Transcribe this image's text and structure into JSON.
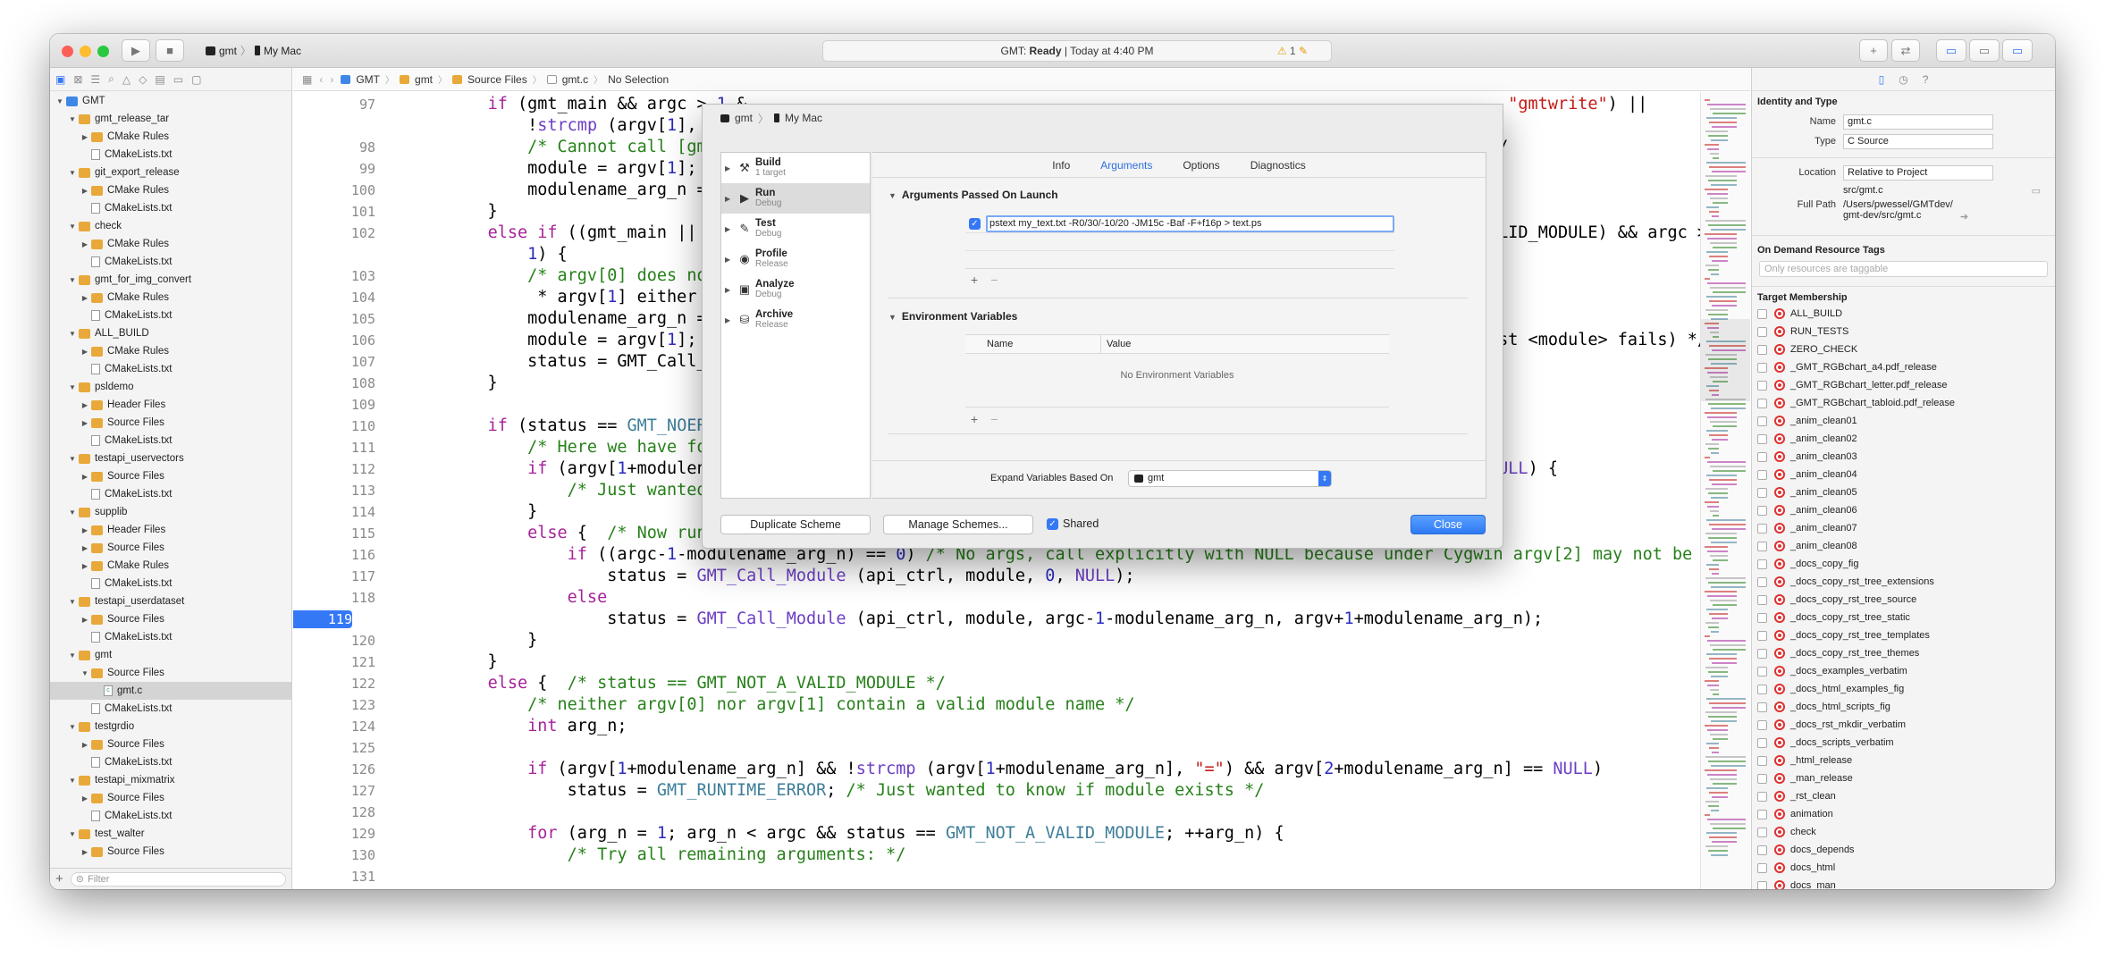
{
  "toolbar": {
    "scheme_target": "gmt",
    "scheme_device": "My Mac",
    "status_prefix": "GMT:",
    "status_state": "Ready",
    "status_time": "| Today at 4:40 PM",
    "warning_count": "1"
  },
  "navigator": {
    "items": [
      {
        "label": "GMT",
        "depth": 0,
        "kind": "project",
        "open": true
      },
      {
        "label": "gmt_release_tar",
        "depth": 1,
        "kind": "folder",
        "open": true
      },
      {
        "label": "CMake Rules",
        "depth": 2,
        "kind": "folder",
        "open": false
      },
      {
        "label": "CMakeLists.txt",
        "depth": 2,
        "kind": "file"
      },
      {
        "label": "git_export_release",
        "depth": 1,
        "kind": "folder",
        "open": true
      },
      {
        "label": "CMake Rules",
        "depth": 2,
        "kind": "folder",
        "open": false
      },
      {
        "label": "CMakeLists.txt",
        "depth": 2,
        "kind": "file"
      },
      {
        "label": "check",
        "depth": 1,
        "kind": "folder",
        "open": true
      },
      {
        "label": "CMake Rules",
        "depth": 2,
        "kind": "folder",
        "open": false
      },
      {
        "label": "CMakeLists.txt",
        "depth": 2,
        "kind": "file"
      },
      {
        "label": "gmt_for_img_convert",
        "depth": 1,
        "kind": "folder",
        "open": true
      },
      {
        "label": "CMake Rules",
        "depth": 2,
        "kind": "folder",
        "open": false
      },
      {
        "label": "CMakeLists.txt",
        "depth": 2,
        "kind": "file"
      },
      {
        "label": "ALL_BUILD",
        "depth": 1,
        "kind": "folder",
        "open": true
      },
      {
        "label": "CMake Rules",
        "depth": 2,
        "kind": "folder",
        "open": false
      },
      {
        "label": "CMakeLists.txt",
        "depth": 2,
        "kind": "file"
      },
      {
        "label": "psldemo",
        "depth": 1,
        "kind": "folder",
        "open": true
      },
      {
        "label": "Header Files",
        "depth": 2,
        "kind": "folder",
        "open": false
      },
      {
        "label": "Source Files",
        "depth": 2,
        "kind": "folder",
        "open": false
      },
      {
        "label": "CMakeLists.txt",
        "depth": 2,
        "kind": "file"
      },
      {
        "label": "testapi_uservectors",
        "depth": 1,
        "kind": "folder",
        "open": true
      },
      {
        "label": "Source Files",
        "depth": 2,
        "kind": "folder",
        "open": false
      },
      {
        "label": "CMakeLists.txt",
        "depth": 2,
        "kind": "file"
      },
      {
        "label": "supplib",
        "depth": 1,
        "kind": "folder",
        "open": true
      },
      {
        "label": "Header Files",
        "depth": 2,
        "kind": "folder",
        "open": false
      },
      {
        "label": "Source Files",
        "depth": 2,
        "kind": "folder",
        "open": false
      },
      {
        "label": "CMake Rules",
        "depth": 2,
        "kind": "folder",
        "open": false
      },
      {
        "label": "CMakeLists.txt",
        "depth": 2,
        "kind": "file"
      },
      {
        "label": "testapi_userdataset",
        "depth": 1,
        "kind": "folder",
        "open": true
      },
      {
        "label": "Source Files",
        "depth": 2,
        "kind": "folder",
        "open": false
      },
      {
        "label": "CMakeLists.txt",
        "depth": 2,
        "kind": "file"
      },
      {
        "label": "gmt",
        "depth": 1,
        "kind": "folder",
        "open": true
      },
      {
        "label": "Source Files",
        "depth": 2,
        "kind": "folder",
        "open": true
      },
      {
        "label": "gmt.c",
        "depth": 3,
        "kind": "cfile",
        "selected": true
      },
      {
        "label": "CMakeLists.txt",
        "depth": 2,
        "kind": "file"
      },
      {
        "label": "testgrdio",
        "depth": 1,
        "kind": "folder",
        "open": true
      },
      {
        "label": "Source Files",
        "depth": 2,
        "kind": "folder",
        "open": false
      },
      {
        "label": "CMakeLists.txt",
        "depth": 2,
        "kind": "file"
      },
      {
        "label": "testapi_mixmatrix",
        "depth": 1,
        "kind": "folder",
        "open": true
      },
      {
        "label": "Source Files",
        "depth": 2,
        "kind": "folder",
        "open": false
      },
      {
        "label": "CMakeLists.txt",
        "depth": 2,
        "kind": "file"
      },
      {
        "label": "test_walter",
        "depth": 1,
        "kind": "folder",
        "open": true
      },
      {
        "label": "Source Files",
        "depth": 2,
        "kind": "folder",
        "open": false
      }
    ],
    "filter_placeholder": "Filter"
  },
  "jumpbar": {
    "crumbs": [
      "GMT",
      "gmt",
      "Source Files",
      "gmt.c",
      "No Selection"
    ]
  },
  "editor": {
    "current_line": "119",
    "lines": [
      {
        "n": "97",
        "t": "    if (gmt_main && argc > 1 &"
      },
      {
        "n": "",
        "t": "        !strcmp (argv[1], \"wri"
      },
      {
        "n": "98",
        "t": "        /* Cannot call [gmt]re"
      },
      {
        "n": "99",
        "t": "        module = argv[1];   /*"
      },
      {
        "n": "100",
        "t": "        modulename_arg_n = 1;"
      },
      {
        "n": "101",
        "t": "    }"
      },
      {
        "n": "102",
        "t": "    else if ((gmt_main || (sta"
      },
      {
        "n": "",
        "t": "        1) {"
      },
      {
        "n": "103",
        "t": "        /* argv[0] does not co"
      },
      {
        "n": "104",
        "t": "         * argv[1] either hol"
      },
      {
        "n": "105",
        "t": "        modulename_arg_n = 1;"
      },
      {
        "n": "106",
        "t": "        module = argv[1];   /"
      },
      {
        "n": "107",
        "t": "        status = GMT_Call_Modu"
      },
      {
        "n": "108",
        "t": "    }"
      },
      {
        "n": "109",
        "t": ""
      },
      {
        "n": "110",
        "t": "    if (status == GMT_NOERROR)"
      },
      {
        "n": "111",
        "t": "        /* Here we have found"
      },
      {
        "n": "112",
        "t": "        if (argv[1+modulename_"
      },
      {
        "n": "113",
        "t": "            /* Just wanted to"
      },
      {
        "n": "114",
        "t": "        }"
      },
      {
        "n": "115",
        "t": "        else {  /* Now run the specified GMT module: */"
      },
      {
        "n": "116",
        "t": "            if ((argc-1-modulename_arg_n) == 0) /* No args, call explicitly with NULL because under Cygwin argv[2] may not be NULL */"
      },
      {
        "n": "117",
        "t": "                status = GMT_Call_Module (api_ctrl, module, 0, NULL);"
      },
      {
        "n": "118",
        "t": "            else"
      },
      {
        "n": "119",
        "t": "                status = GMT_Call_Module (api_ctrl, module, argc-1-modulename_arg_n, argv+1+modulename_arg_n);"
      },
      {
        "n": "120",
        "t": "        }"
      },
      {
        "n": "121",
        "t": "    }"
      },
      {
        "n": "122",
        "t": "    else {  /* status == GMT_NOT_A_VALID_MODULE */"
      },
      {
        "n": "123",
        "t": "        /* neither argv[0] nor argv[1] contain a valid module name */"
      },
      {
        "n": "124",
        "t": "        int arg_n;"
      },
      {
        "n": "125",
        "t": ""
      },
      {
        "n": "126",
        "t": "        if (argv[1+modulename_arg_n] && !strcmp (argv[1+modulename_arg_n], \"=\") && argv[2+modulename_arg_n] == NULL)"
      },
      {
        "n": "127",
        "t": "            status = GMT_RUNTIME_ERROR; /* Just wanted to know if module exists */"
      },
      {
        "n": "128",
        "t": ""
      },
      {
        "n": "129",
        "t": "        for (arg_n = 1; arg_n < argc && status == GMT_NOT_A_VALID_MODULE; ++arg_n) {"
      },
      {
        "n": "130",
        "t": "            /* Try all remaining arguments: */"
      },
      {
        "n": "131",
        "t": ""
      }
    ],
    "right_fragments": [
      {
        "row": 0,
        "t": ", \"gmtwrite\") ||"
      },
      {
        "row": 2,
        "t": "*/"
      },
      {
        "row": 6,
        "t": "ALID_MODULE) && argc >"
      },
      {
        "row": 11,
        "t": "ust <module> fails) */"
      },
      {
        "row": 17,
        "t": "NULL) {"
      }
    ]
  },
  "scheme_editor": {
    "header_target": "gmt",
    "header_device": "My Mac",
    "actions": [
      {
        "name": "Build",
        "sub": "1 target"
      },
      {
        "name": "Run",
        "sub": "Debug",
        "selected": true
      },
      {
        "name": "Test",
        "sub": "Debug"
      },
      {
        "name": "Profile",
        "sub": "Release"
      },
      {
        "name": "Analyze",
        "sub": "Debug"
      },
      {
        "name": "Archive",
        "sub": "Release"
      }
    ],
    "tabs": [
      "Info",
      "Arguments",
      "Options",
      "Diagnostics"
    ],
    "active_tab": "Arguments",
    "args_section": "Arguments Passed On Launch",
    "argument_value": "pstext my_text.txt -R0/30/-10/20 -JM15c -Baf -F+f16p > text.ps",
    "env_section": "Environment Variables",
    "env_col_name": "Name",
    "env_col_value": "Value",
    "env_empty": "No Environment Variables",
    "expand_label": "Expand Variables Based On",
    "expand_value": "gmt",
    "duplicate_label": "Duplicate Scheme",
    "manage_label": "Manage Schemes...",
    "shared_label": "Shared",
    "close_label": "Close"
  },
  "inspector": {
    "identity_heading": "Identity and Type",
    "name_label": "Name",
    "name_value": "gmt.c",
    "type_label": "Type",
    "type_value": "C Source",
    "location_label": "Location",
    "location_value": "Relative to Project",
    "location_path": "src/gmt.c",
    "fullpath_label": "Full Path",
    "fullpath_value_1": "/Users/pwessel/GMTdev/",
    "fullpath_value_2": "gmt-dev/src/gmt.c",
    "tags_heading": "On Demand Resource Tags",
    "tags_placeholder": "Only resources are taggable",
    "membership_heading": "Target Membership",
    "targets": [
      "ALL_BUILD",
      "RUN_TESTS",
      "ZERO_CHECK",
      "_GMT_RGBchart_a4.pdf_release",
      "_GMT_RGBchart_letter.pdf_release",
      "_GMT_RGBchart_tabloid.pdf_release",
      "_anim_clean01",
      "_anim_clean02",
      "_anim_clean03",
      "_anim_clean04",
      "_anim_clean05",
      "_anim_clean06",
      "_anim_clean07",
      "_anim_clean08",
      "_docs_copy_fig",
      "_docs_copy_rst_tree_extensions",
      "_docs_copy_rst_tree_source",
      "_docs_copy_rst_tree_static",
      "_docs_copy_rst_tree_templates",
      "_docs_copy_rst_tree_themes",
      "_docs_examples_verbatim",
      "_docs_html_examples_fig",
      "_docs_html_scripts_fig",
      "_docs_rst_mkdir_verbatim",
      "_docs_scripts_verbatim",
      "_html_release",
      "_man_release",
      "_rst_clean",
      "animation",
      "check",
      "docs_depends",
      "docs_html",
      "docs_man"
    ]
  }
}
